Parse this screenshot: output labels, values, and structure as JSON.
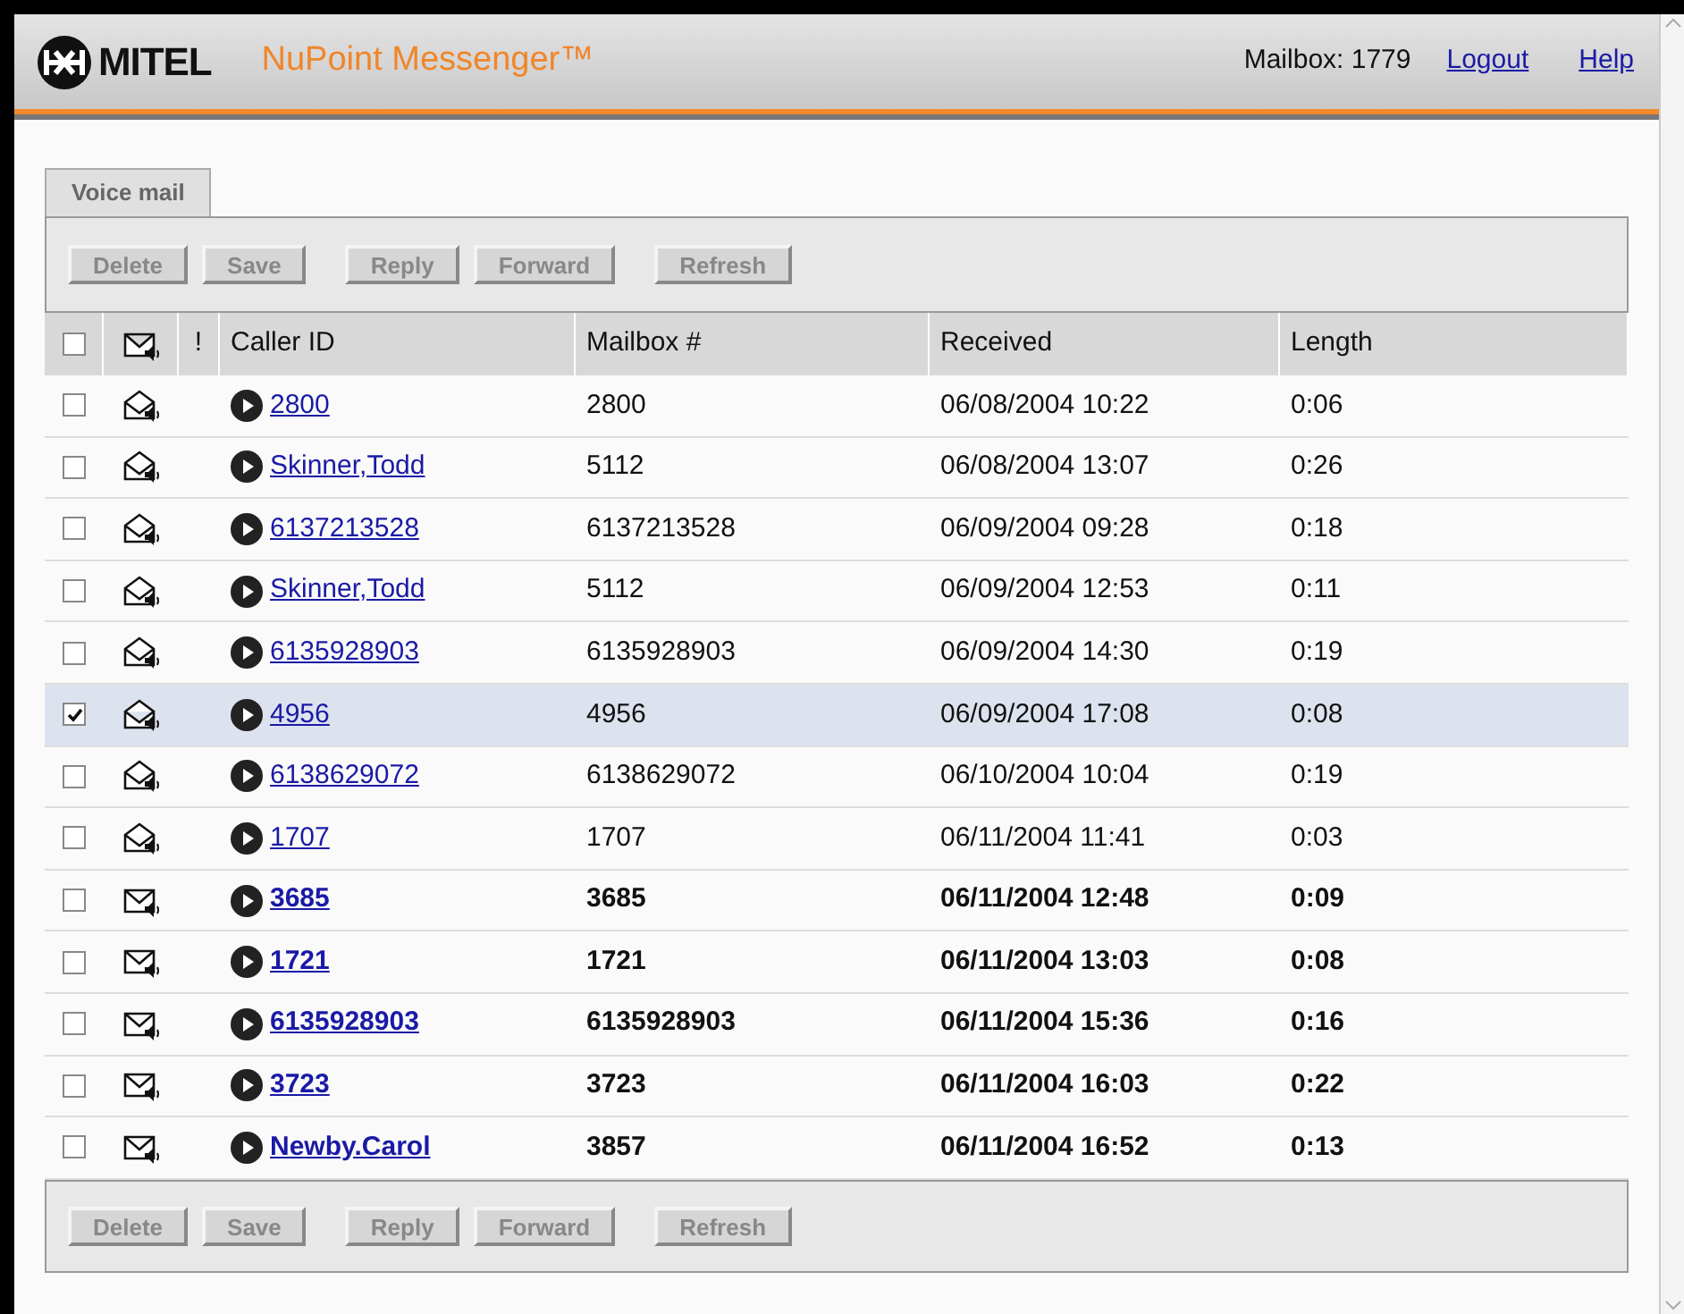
{
  "header": {
    "logo": "MITEL",
    "product": "NuPoint Messenger™",
    "mailbox": "Mailbox: 1779",
    "links": [
      "Logout",
      "Help"
    ]
  },
  "tabs": [
    {
      "label": "Voice mail",
      "selected": true
    }
  ],
  "toolbar_top": [
    "Delete",
    "Save",
    "Reply",
    "Forward",
    "Refresh"
  ],
  "table": {
    "select_all_checked": false,
    "columns": [
      "!",
      "Caller ID",
      "Mailbox #",
      "Received",
      "Length"
    ],
    "rows": [
      {
        "checked": false,
        "selected": false,
        "read": true,
        "caller": "2800",
        "mailbox": "2800",
        "received": "06/08/2004 10:22",
        "length": "0:06"
      },
      {
        "checked": false,
        "selected": false,
        "read": true,
        "caller": "Skinner,Todd",
        "mailbox": "5112",
        "received": "06/08/2004 13:07",
        "length": "0:26"
      },
      {
        "checked": false,
        "selected": false,
        "read": true,
        "caller": "6137213528",
        "mailbox": "6137213528",
        "received": "06/09/2004 09:28",
        "length": "0:18"
      },
      {
        "checked": false,
        "selected": false,
        "read": true,
        "caller": "Skinner,Todd",
        "mailbox": "5112",
        "received": "06/09/2004 12:53",
        "length": "0:11"
      },
      {
        "checked": false,
        "selected": false,
        "read": true,
        "caller": "6135928903",
        "mailbox": "6135928903",
        "received": "06/09/2004 14:30",
        "length": "0:19"
      },
      {
        "checked": true,
        "selected": true,
        "read": true,
        "caller": "4956",
        "mailbox": "4956",
        "received": "06/09/2004 17:08",
        "length": "0:08"
      },
      {
        "checked": false,
        "selected": false,
        "read": true,
        "caller": "6138629072",
        "mailbox": "6138629072",
        "received": "06/10/2004 10:04",
        "length": "0:19"
      },
      {
        "checked": false,
        "selected": false,
        "read": true,
        "caller": "1707",
        "mailbox": "1707",
        "received": "06/11/2004 11:41",
        "length": "0:03"
      },
      {
        "checked": false,
        "selected": false,
        "read": false,
        "caller": "3685",
        "mailbox": "3685",
        "received": "06/11/2004 12:48",
        "length": "0:09"
      },
      {
        "checked": false,
        "selected": false,
        "read": false,
        "caller": "1721",
        "mailbox": "1721",
        "received": "06/11/2004 13:03",
        "length": "0:08"
      },
      {
        "checked": false,
        "selected": false,
        "read": false,
        "caller": "6135928903",
        "mailbox": "6135928903",
        "received": "06/11/2004 15:36",
        "length": "0:16"
      },
      {
        "checked": false,
        "selected": false,
        "read": false,
        "caller": "3723",
        "mailbox": "3723",
        "received": "06/11/2004 16:03",
        "length": "0:22"
      },
      {
        "checked": false,
        "selected": false,
        "read": false,
        "caller": "Newby.Carol",
        "mailbox": "3857",
        "received": "06/11/2004 16:52",
        "length": "0:13"
      }
    ]
  },
  "toolbar_bottom": [
    "Delete",
    "Save",
    "Reply",
    "Forward",
    "Refresh"
  ]
}
